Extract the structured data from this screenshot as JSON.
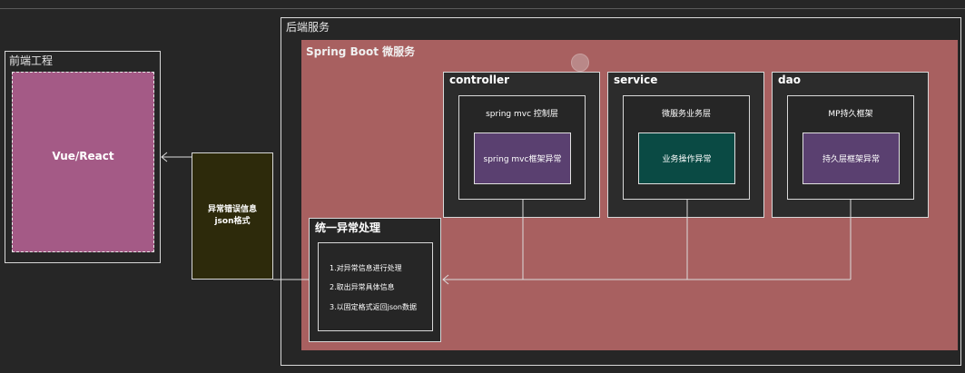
{
  "frontend": {
    "title": "前端工程",
    "app": "Vue/React"
  },
  "backend": {
    "title": "后端服务"
  },
  "springboot": {
    "title": "Spring Boot 微服务"
  },
  "layers": [
    {
      "title": "controller",
      "inner_title": "spring mvc 控制层",
      "core": "spring mvc框架异常",
      "core_color": "#5a4070"
    },
    {
      "title": "service",
      "inner_title": "微服务业务层",
      "core": "业务操作异常",
      "core_color": "#0a4a44"
    },
    {
      "title": "dao",
      "inner_title": "MP持久框架",
      "core": "持久层框架异常",
      "core_color": "#5a4070"
    }
  ],
  "json_box": {
    "line1": "异常错误信息",
    "line2": "json格式"
  },
  "handler": {
    "title": "统一异常处理",
    "steps": [
      "1.对异常信息进行处理",
      "2.取出异常具体信息",
      "3.以固定格式返回json数据"
    ]
  },
  "colors": {
    "background": "#262626",
    "springboot": "#a86060",
    "vue": "#a45a86",
    "json_box": "#2d2a0b"
  }
}
